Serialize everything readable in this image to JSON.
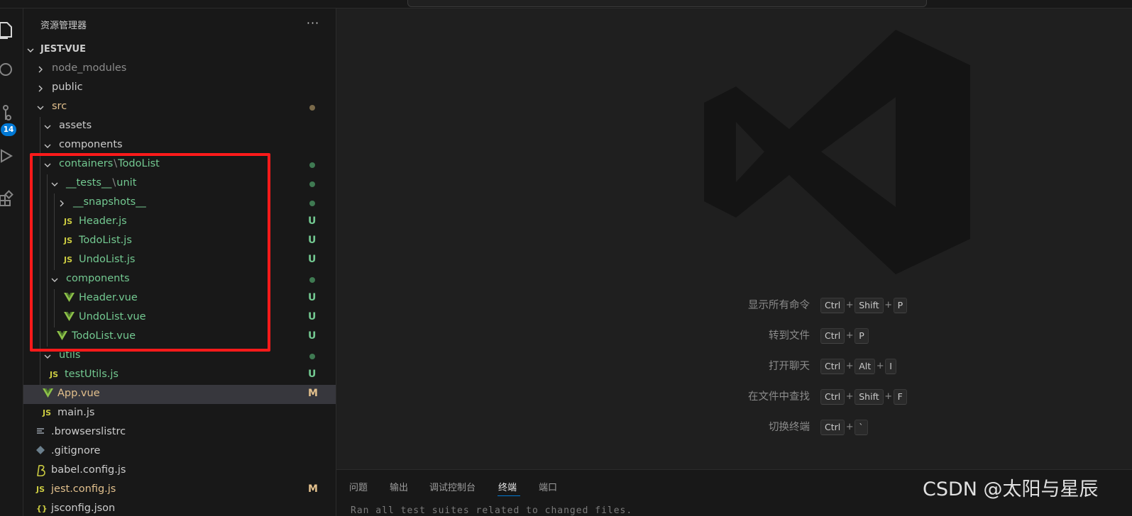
{
  "explorer": {
    "title": "资源管理器",
    "more_label": "···",
    "root_label": "JEST-VUE"
  },
  "activity_bar": {
    "source_control_badge": "14",
    "icons": [
      "explorer-icon",
      "search-icon",
      "source-control-icon",
      "run-debug-icon",
      "extensions-icon"
    ]
  },
  "tree": [
    {
      "label": "node_modules",
      "type": "folder",
      "expanded": false,
      "color": "#8b8b8b",
      "decoration": ""
    },
    {
      "label": "public",
      "type": "folder",
      "expanded": false,
      "color": "#cccccc",
      "decoration": ""
    },
    {
      "label": "src",
      "type": "folder",
      "expanded": true,
      "color": "#e2c08d",
      "decoration": "dot-yellow"
    },
    {
      "label": "assets",
      "type": "folder",
      "expanded": true,
      "color": "#cccccc",
      "decoration": ""
    },
    {
      "label": "components",
      "type": "folder",
      "expanded": true,
      "color": "#cccccc",
      "decoration": ""
    },
    {
      "label_parts": [
        "containers",
        "TodoList"
      ],
      "type": "folder",
      "expanded": true,
      "color": "#73c991",
      "decoration": "dot-green"
    },
    {
      "label_parts": [
        "__tests__",
        "unit"
      ],
      "type": "folder",
      "expanded": true,
      "color": "#73c991",
      "decoration": "dot-green"
    },
    {
      "label": "__snapshots__",
      "type": "folder",
      "expanded": false,
      "color": "#73c991",
      "decoration": "dot-green"
    },
    {
      "label": "Header.js",
      "type": "js",
      "color": "#73c991",
      "decoration": "U"
    },
    {
      "label": "TodoList.js",
      "type": "js",
      "color": "#73c991",
      "decoration": "U"
    },
    {
      "label": "UndoList.js",
      "type": "js",
      "color": "#73c991",
      "decoration": "U"
    },
    {
      "label": "components",
      "type": "folder",
      "expanded": true,
      "color": "#73c991",
      "decoration": "dot-green"
    },
    {
      "label": "Header.vue",
      "type": "vue",
      "color": "#73c991",
      "decoration": "U"
    },
    {
      "label": "UndoList.vue",
      "type": "vue",
      "color": "#73c991",
      "decoration": "U"
    },
    {
      "label": "TodoList.vue",
      "type": "vue",
      "color": "#73c991",
      "decoration": "U"
    },
    {
      "label": "utils",
      "type": "folder",
      "expanded": true,
      "color": "#73c991",
      "decoration": "dot-green"
    },
    {
      "label": "testUtils.js",
      "type": "js",
      "color": "#73c991",
      "decoration": "U"
    },
    {
      "label": "App.vue",
      "type": "vue",
      "color": "#e2c08d",
      "decoration": "M",
      "selected": true
    },
    {
      "label": "main.js",
      "type": "js",
      "color": "#cccccc",
      "decoration": ""
    },
    {
      "label": ".browserslistrc",
      "type": "config",
      "color": "#cccccc",
      "decoration": ""
    },
    {
      "label": ".gitignore",
      "type": "git",
      "color": "#cccccc",
      "decoration": ""
    },
    {
      "label": "babel.config.js",
      "type": "babel",
      "color": "#cccccc",
      "decoration": ""
    },
    {
      "label": "jest.config.js",
      "type": "js",
      "color": "#e2c08d",
      "decoration": "M"
    },
    {
      "label": "jsconfig.json",
      "type": "json",
      "color": "#cccccc",
      "decoration": ""
    }
  ],
  "icon_text": {
    "js": "JS",
    "json": "{}"
  },
  "shortcuts": [
    {
      "label": "显示所有命令",
      "keys": [
        "Ctrl",
        "Shift",
        "P"
      ]
    },
    {
      "label": "转到文件",
      "keys": [
        "Ctrl",
        "P"
      ]
    },
    {
      "label": "打开聊天",
      "keys": [
        "Ctrl",
        "Alt",
        "I"
      ]
    },
    {
      "label": "在文件中查找",
      "keys": [
        "Ctrl",
        "Shift",
        "F"
      ]
    },
    {
      "label": "切换终端",
      "keys": [
        "Ctrl",
        "`"
      ]
    }
  ],
  "panel": {
    "tabs": [
      "问题",
      "输出",
      "调试控制台",
      "终端",
      "端口"
    ],
    "active_tab": "终端",
    "partial_text": "Ran all test suites related to changed files."
  },
  "watermark": "CSDN @太阳与星辰",
  "colors": {
    "git_untracked": "#73c991",
    "git_modified": "#e2c08d",
    "badge": "#0078d4",
    "highlight_box": "#ff1a1a",
    "js_icon": "#cbcb41",
    "vue_icon": "#8dc149"
  }
}
